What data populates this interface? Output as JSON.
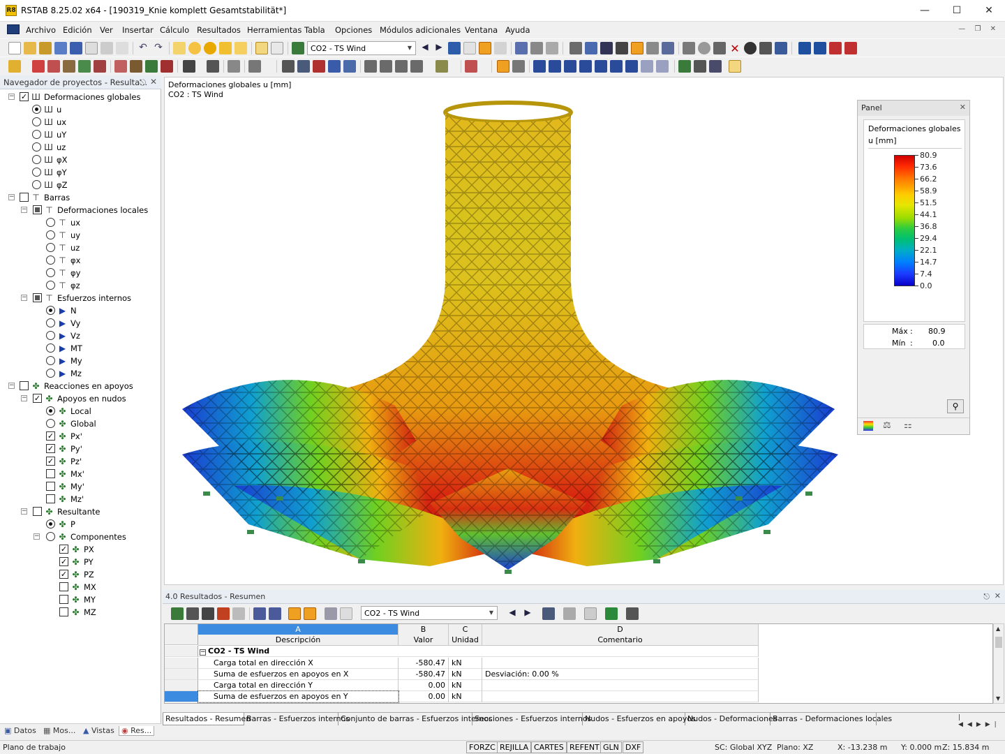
{
  "window": {
    "title": "RSTAB 8.25.02 x64 - [190319_Knie komplett Gesamtstabilität*]",
    "app_icon": "R8"
  },
  "menu": [
    "Archivo",
    "Edición",
    "Ver",
    "Insertar",
    "Cálculo",
    "Resultados",
    "Herramientas",
    "Tabla",
    "Opciones",
    "Módulos adicionales",
    "Ventana",
    "Ayuda"
  ],
  "toolbar": {
    "loadcase_combo": "CO2 - TS Wind"
  },
  "navigator": {
    "title": "Navegador de proyectos - Resulta...",
    "tabs": [
      "Datos",
      "Mos...",
      "Vistas",
      "Res..."
    ]
  },
  "tree": {
    "global_def": "Deformaciones globales",
    "g_u": "u",
    "g_ux": "ux",
    "g_uy": "uY",
    "g_uz": "uz",
    "g_px": "φX",
    "g_py": "φY",
    "g_pz": "φZ",
    "barras": "Barras",
    "local_def": "Deformaciones locales",
    "l_ux": "ux",
    "l_uy": "uy",
    "l_uz": "uz",
    "l_px": "φx",
    "l_py": "φy",
    "l_pz": "φz",
    "internal": "Esfuerzos internos",
    "i_n": "N",
    "i_vy": "Vy",
    "i_vz": "Vz",
    "i_mt": "MT",
    "i_my": "My",
    "i_mz": "Mz",
    "reactions": "Reacciones en apoyos",
    "nodal": "Apoyos en nudos",
    "r_local": "Local",
    "r_global": "Global",
    "r_px": "Px'",
    "r_py": "Py'",
    "r_pz": "Pz'",
    "r_mx": "Mx'",
    "r_my": "My'",
    "r_mz": "Mz'",
    "resultant": "Resultante",
    "res_p": "P",
    "components": "Componentes",
    "c_px": "PX",
    "c_py": "PY",
    "c_pz": "PZ",
    "c_mx": "MX",
    "c_my": "MY",
    "c_mz": "MZ"
  },
  "viewport": {
    "label1": "Deformaciones globales u [mm]",
    "label2": "CO2 : TS Wind"
  },
  "panel": {
    "title": "Panel",
    "heading": "Deformaciones globales",
    "unit": "u [mm]",
    "scale": [
      "80.9",
      "73.6",
      "66.2",
      "58.9",
      "51.5",
      "44.1",
      "36.8",
      "29.4",
      "22.1",
      "14.7",
      "7.4",
      "0.0"
    ],
    "max_label": "Máx",
    "max_value": "80.9",
    "min_label": "Mín",
    "min_value": "0.0",
    "colors": [
      "#d00000",
      "#ff2a00",
      "#ff7a00",
      "#ffcc00",
      "#e6e600",
      "#9bdc00",
      "#2ecc40",
      "#00c070",
      "#00b0c0",
      "#0080ff",
      "#1a3cff",
      "#0a00c8"
    ]
  },
  "results": {
    "title": "4.0 Resultados - Resumen",
    "combo": "CO2 - TS Wind",
    "col_letters": [
      "A",
      "B",
      "C",
      "D"
    ],
    "col_headers": [
      "Descripción",
      "Valor",
      "Unidad",
      "Comentario"
    ],
    "group": "CO2 - TS Wind",
    "rows": [
      {
        "desc": "Carga total en dirección X",
        "value": "-580.47",
        "unit": "kN",
        "comment": ""
      },
      {
        "desc": "Suma de esfuerzos en apoyos en X",
        "value": "-580.47",
        "unit": "kN",
        "comment": "Desviación:  0.00 %"
      },
      {
        "desc": "Carga total en dirección Y",
        "value": "0.00",
        "unit": "kN",
        "comment": ""
      },
      {
        "desc": "Suma de esfuerzos en apoyos en Y",
        "value": "0.00",
        "unit": "kN",
        "comment": ""
      }
    ],
    "tabs": [
      "Resultados - Resumen",
      "Barras - Esfuerzos internos",
      "Conjunto de barras - Esfuerzos internos",
      "Secciones - Esfuerzos internos",
      "Nudos - Esfuerzos en apoyos",
      "Nudos - Deformaciones",
      "Barras - Deformaciones locales"
    ]
  },
  "status": {
    "left": "Plano de trabajo",
    "buttons": [
      "FORZC",
      "REJILLA",
      "CARTES",
      "REFENT",
      "GLN",
      "DXF"
    ],
    "sc": "SC: Global XYZ",
    "plane": "Plano: XZ",
    "x": "X:  -13.238 m",
    "y": "Y:  0.000 m",
    "z": "Z:  15.834 m"
  }
}
